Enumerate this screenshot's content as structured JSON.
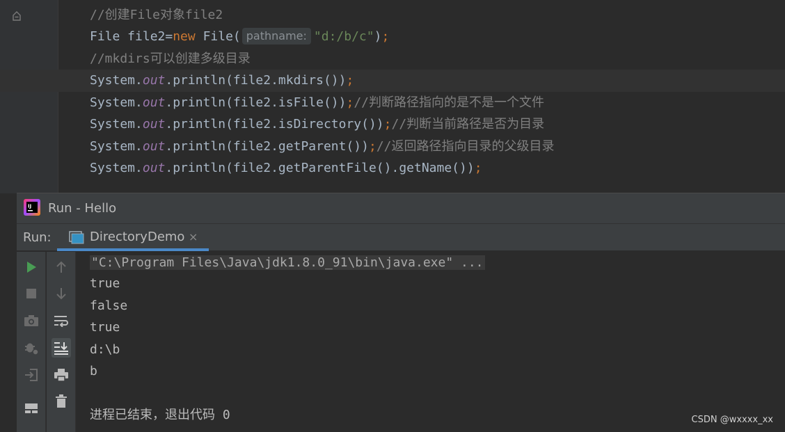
{
  "editor": {
    "lines": {
      "l1": {
        "comment": "//创建File对象file2"
      },
      "l2": {
        "a": "File file2=",
        "kw": "new",
        "b": " File(",
        "hint": "pathname:",
        "str": "\"d:/b/c\"",
        "c": ")",
        "semi": ";"
      },
      "l3": {
        "comment": "//mkdirs可以创建多级目录"
      },
      "l4": {
        "a": "System.",
        "field": "out",
        "b": ".println(file2.mkdirs())",
        "semi": ";"
      },
      "l5": {
        "a": "System.",
        "field": "out",
        "b": ".println(file2.isFile())",
        "semi": ";",
        "comment": "//判断路径指向的是不是一个文件"
      },
      "l6": {
        "a": "System.",
        "field": "out",
        "b": ".println(file2.isDirectory())",
        "semi": ";",
        "comment": "//判断当前路径是否为目录"
      },
      "l7": {
        "a": "System.",
        "field": "out",
        "b": ".println(file2.getParent())",
        "semi": ";",
        "comment": "//返回路径指向目录的父级目录"
      },
      "l8": {
        "a": "System.",
        "field": "out",
        "b": ".println(file2.getParentFile().getName())",
        "semi": ";"
      }
    }
  },
  "run_window": {
    "title": "Run - Hello",
    "run_label": "Run:",
    "tab": {
      "label": "DirectoryDemo",
      "close": "×"
    },
    "toolbar_left": [
      "rerun-icon",
      "stop-icon",
      "camera-icon",
      "debug-settings-icon",
      "login-icon",
      "layout-icon"
    ],
    "toolbar_right": [
      "up-arrow-icon",
      "down-arrow-icon",
      "soft-wrap-icon",
      "scroll-to-end-icon",
      "print-icon",
      "trash-icon"
    ],
    "console": {
      "command": "\"C:\\Program Files\\Java\\jdk1.8.0_91\\bin\\java.exe\" ...",
      "output": [
        "true",
        "false",
        "true",
        "d:\\b",
        "b"
      ],
      "exit": "进程已结束，退出代码 0"
    }
  },
  "watermark": "CSDN @wxxxx_xx",
  "colors": {
    "keyword": "#cc7832",
    "comment": "#808080",
    "string": "#6a8759",
    "field": "#9876aa",
    "accent": "#4a88c7",
    "run_green": "#499c54"
  }
}
